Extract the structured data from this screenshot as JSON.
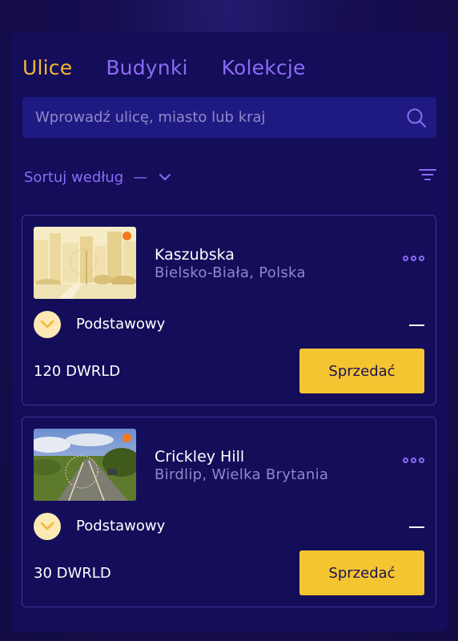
{
  "tabs": [
    {
      "label": "Ulice",
      "active": true
    },
    {
      "label": "Budynki",
      "active": false
    },
    {
      "label": "Kolekcje",
      "active": false
    }
  ],
  "search": {
    "placeholder": "Wprowadź ulicę, miasto lub kraj",
    "value": ""
  },
  "sort": {
    "label": "Sortuj według",
    "value": "—"
  },
  "cards": [
    {
      "street": "Kaszubska",
      "city": "Bielsko-Biała, Polska",
      "tier": "Podstawowy",
      "tier_value": "—",
      "price": "120 DWRLD",
      "action": "Sprzedać"
    },
    {
      "street": "Crickley Hill",
      "city": "Birdlip, Wielka Brytania",
      "tier": "Podstawowy",
      "tier_value": "—",
      "price": "30 DWRLD",
      "action": "Sprzedać"
    }
  ],
  "colors": {
    "accent_active": "#f4b731",
    "accent": "#8a6cf4",
    "button": "#f4c431",
    "panel": "#140d5a"
  },
  "icons": [
    "search-icon",
    "chevron-down-icon",
    "filter-icon",
    "more-icon",
    "chevron-down-icon"
  ]
}
